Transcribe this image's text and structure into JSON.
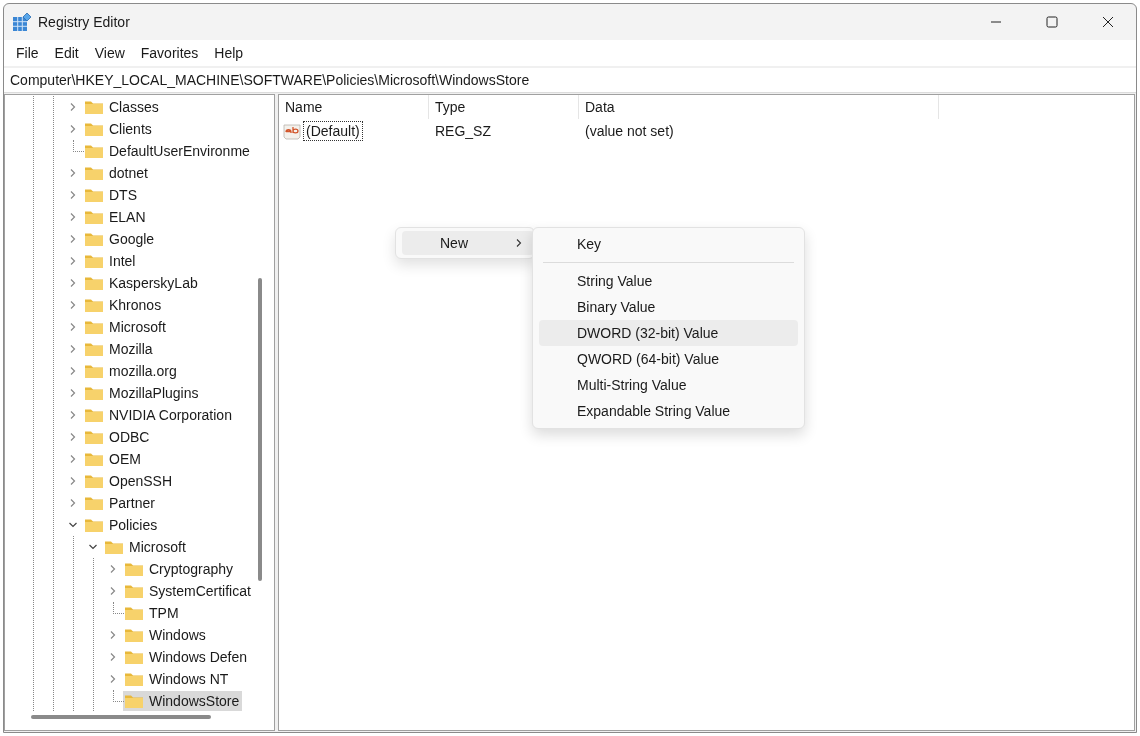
{
  "window": {
    "title": "Registry Editor"
  },
  "menu": [
    "File",
    "Edit",
    "View",
    "Favorites",
    "Help"
  ],
  "address": "Computer\\HKEY_LOCAL_MACHINE\\SOFTWARE\\Policies\\Microsoft\\WindowsStore",
  "tree": [
    {
      "name": "Classes",
      "kind": "branch",
      "expanded": false,
      "selected": false
    },
    {
      "name": "Clients",
      "kind": "branch",
      "expanded": false,
      "selected": false
    },
    {
      "name": "DefaultUserEnvironme",
      "kind": "leaf",
      "selected": false
    },
    {
      "name": "dotnet",
      "kind": "branch",
      "expanded": false,
      "selected": false
    },
    {
      "name": "DTS",
      "kind": "branch",
      "expanded": false,
      "selected": false
    },
    {
      "name": "ELAN",
      "kind": "branch",
      "expanded": false,
      "selected": false
    },
    {
      "name": "Google",
      "kind": "branch",
      "expanded": false,
      "selected": false
    },
    {
      "name": "Intel",
      "kind": "branch",
      "expanded": false,
      "selected": false
    },
    {
      "name": "KasperskyLab",
      "kind": "branch",
      "expanded": false,
      "selected": false
    },
    {
      "name": "Khronos",
      "kind": "branch",
      "expanded": false,
      "selected": false
    },
    {
      "name": "Microsoft",
      "kind": "branch",
      "expanded": false,
      "selected": false
    },
    {
      "name": "Mozilla",
      "kind": "branch",
      "expanded": false,
      "selected": false
    },
    {
      "name": "mozilla.org",
      "kind": "branch",
      "expanded": false,
      "selected": false
    },
    {
      "name": "MozillaPlugins",
      "kind": "branch",
      "expanded": false,
      "selected": false
    },
    {
      "name": "NVIDIA Corporation",
      "kind": "branch",
      "expanded": false,
      "selected": false
    },
    {
      "name": "ODBC",
      "kind": "branch",
      "expanded": false,
      "selected": false
    },
    {
      "name": "OEM",
      "kind": "branch",
      "expanded": false,
      "selected": false
    },
    {
      "name": "OpenSSH",
      "kind": "branch",
      "expanded": false,
      "selected": false
    },
    {
      "name": "Partner",
      "kind": "branch",
      "expanded": false,
      "selected": false
    },
    {
      "name": "Policies",
      "kind": "branch",
      "expanded": true,
      "selected": false,
      "children": [
        {
          "name": "Microsoft",
          "kind": "branch",
          "expanded": true,
          "selected": false,
          "children": [
            {
              "name": "Cryptography",
              "kind": "branch",
              "expanded": false,
              "selected": false
            },
            {
              "name": "SystemCertificat",
              "kind": "branch",
              "expanded": false,
              "selected": false
            },
            {
              "name": "TPM",
              "kind": "leaf",
              "selected": false
            },
            {
              "name": "Windows",
              "kind": "branch",
              "expanded": false,
              "selected": false
            },
            {
              "name": "Windows Defen",
              "kind": "branch",
              "expanded": false,
              "selected": false
            },
            {
              "name": "Windows NT",
              "kind": "branch",
              "expanded": false,
              "selected": false
            },
            {
              "name": "WindowsStore",
              "kind": "leaf",
              "selected": true
            }
          ]
        }
      ]
    }
  ],
  "list": {
    "columns": [
      "Name",
      "Type",
      "Data"
    ],
    "rows": [
      {
        "name": "(Default)",
        "type": "REG_SZ",
        "data": "(value not set)",
        "focused": true
      }
    ]
  },
  "context_menu": {
    "items": [
      {
        "label": "New",
        "selected": true
      }
    ],
    "submenu": [
      {
        "label": "Key",
        "kind": "item",
        "selected": false
      },
      {
        "kind": "separator"
      },
      {
        "label": "String Value",
        "kind": "item",
        "selected": false
      },
      {
        "label": "Binary Value",
        "kind": "item",
        "selected": false
      },
      {
        "label": "DWORD (32-bit) Value",
        "kind": "item",
        "selected": true
      },
      {
        "label": "QWORD (64-bit) Value",
        "kind": "item",
        "selected": false
      },
      {
        "label": "Multi-String Value",
        "kind": "item",
        "selected": false
      },
      {
        "label": "Expandable String Value",
        "kind": "item",
        "selected": false
      }
    ]
  }
}
